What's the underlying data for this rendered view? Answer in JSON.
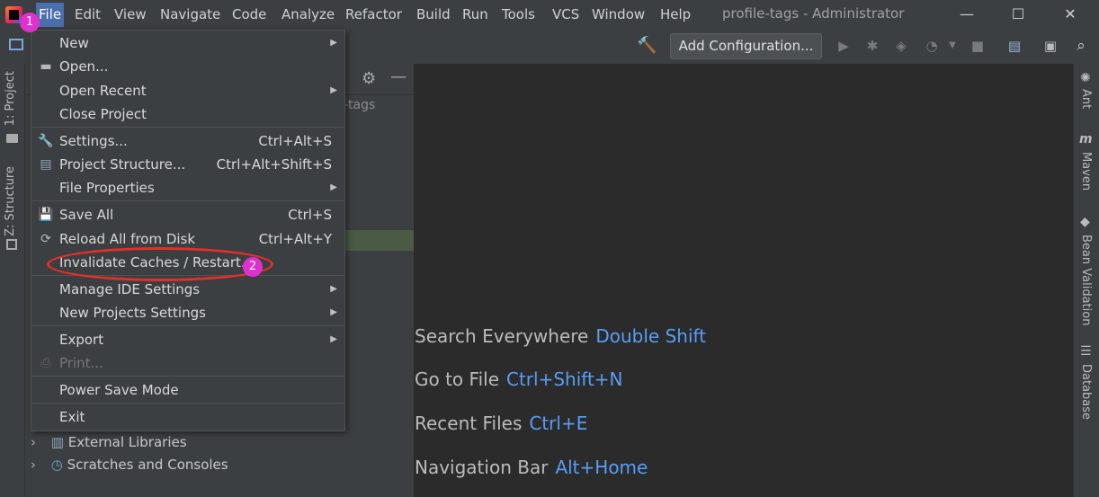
{
  "menubar": {
    "items": [
      "File",
      "Edit",
      "View",
      "Navigate",
      "Code",
      "Analyze",
      "Refactor",
      "Build",
      "Run",
      "Tools",
      "VCS",
      "Window",
      "Help"
    ],
    "title": "profile-tags - Administrator",
    "win_minimize": "—",
    "win_maximize": "☐",
    "win_close": "✕"
  },
  "toolbar": {
    "add_configuration": "Add Configuration..."
  },
  "left_strip": {
    "project_tab": "1: Project",
    "structure_tab": "Z: Structure"
  },
  "right_strip": {
    "ant": "Ant",
    "maven": "Maven",
    "bean_validation": "Bean Validation",
    "database": "Database"
  },
  "project_panel": {
    "root_fragment": "-tags",
    "rows": [
      "External Libraries",
      "Scratches and Consoles"
    ]
  },
  "file_menu": {
    "items": [
      {
        "label": "New",
        "shortcut": "",
        "submenu": true,
        "icon": "none"
      },
      {
        "label": "Open...",
        "shortcut": "",
        "submenu": false,
        "icon": "folder-icon"
      },
      {
        "label": "Open Recent",
        "shortcut": "",
        "submenu": true,
        "icon": "none"
      },
      {
        "label": "Close Project",
        "shortcut": "",
        "submenu": false,
        "icon": "none"
      },
      {
        "label": "Settings...",
        "shortcut": "Ctrl+Alt+S",
        "submenu": false,
        "icon": "wrench-icon"
      },
      {
        "label": "Project Structure...",
        "shortcut": "Ctrl+Alt+Shift+S",
        "submenu": false,
        "icon": "project-structure-icon"
      },
      {
        "label": "File Properties",
        "shortcut": "",
        "submenu": true,
        "icon": "none"
      },
      {
        "label": "Save All",
        "shortcut": "Ctrl+S",
        "submenu": false,
        "icon": "save-icon"
      },
      {
        "label": "Reload All from Disk",
        "shortcut": "Ctrl+Alt+Y",
        "submenu": false,
        "icon": "reload-icon"
      },
      {
        "label": "Invalidate Caches / Restart...",
        "shortcut": "",
        "submenu": false,
        "icon": "none"
      },
      {
        "label": "Manage IDE Settings",
        "shortcut": "",
        "submenu": true,
        "icon": "none"
      },
      {
        "label": "New Projects Settings",
        "shortcut": "",
        "submenu": true,
        "icon": "none"
      },
      {
        "label": "Export",
        "shortcut": "",
        "submenu": true,
        "icon": "none"
      },
      {
        "label": "Print...",
        "shortcut": "",
        "submenu": false,
        "icon": "print-icon",
        "disabled": true
      },
      {
        "label": "Power Save Mode",
        "shortcut": "",
        "submenu": false,
        "icon": "none"
      },
      {
        "label": "Exit",
        "shortcut": "",
        "submenu": false,
        "icon": "none"
      }
    ]
  },
  "editor_hints": [
    {
      "label": "Search Everywhere",
      "key": "Double Shift"
    },
    {
      "label": "Go to File",
      "key": "Ctrl+Shift+N"
    },
    {
      "label": "Recent Files",
      "key": "Ctrl+E"
    },
    {
      "label": "Navigation Bar",
      "key": "Alt+Home"
    }
  ],
  "annotations": {
    "badge1": "1",
    "badge2": "2"
  },
  "colors": {
    "accent": "#4b6eaf",
    "link_key": "#589df6",
    "annotation_red": "#e0302a",
    "badge_magenta": "#e030d0"
  }
}
